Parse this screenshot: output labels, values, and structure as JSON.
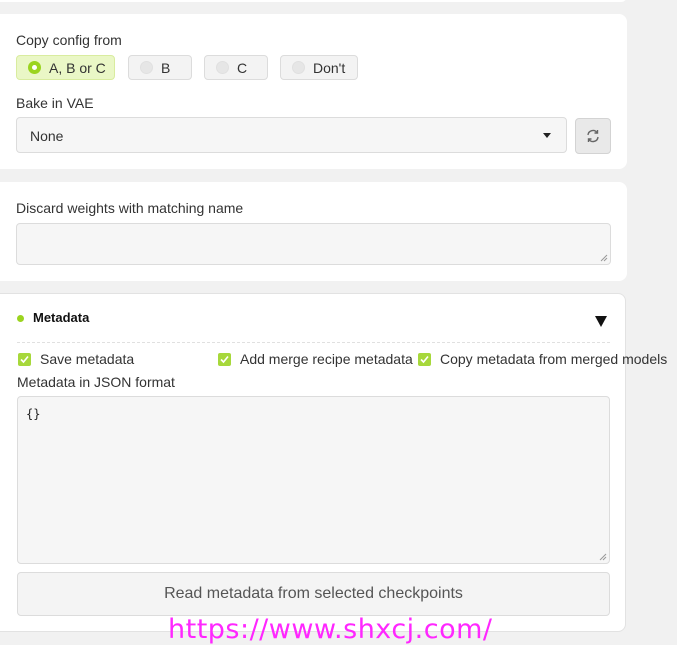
{
  "copy_config": {
    "label": "Copy config from",
    "options": [
      "A, B or C",
      "B",
      "C",
      "Don't"
    ],
    "selected": "A, B or C"
  },
  "bake_vae": {
    "label": "Bake in VAE",
    "value": "None",
    "refresh_icon": "refresh-icon"
  },
  "discard": {
    "label": "Discard weights with matching name",
    "value": ""
  },
  "metadata": {
    "title": "Metadata",
    "expand_icon": "triangle-down-icon",
    "save_label": "Save metadata",
    "recipe_label": "Add merge recipe metadata",
    "copy_label": "Copy metadata from merged models",
    "json_label": "Metadata in JSON format",
    "json_value": "{}",
    "read_button": "Read metadata from selected checkpoints"
  },
  "watermark": "https://www.shxcj.com/",
  "colors": {
    "accent": "#9bd41f",
    "checkbox": "#a7d83b",
    "watermark": "#ff27ff"
  }
}
